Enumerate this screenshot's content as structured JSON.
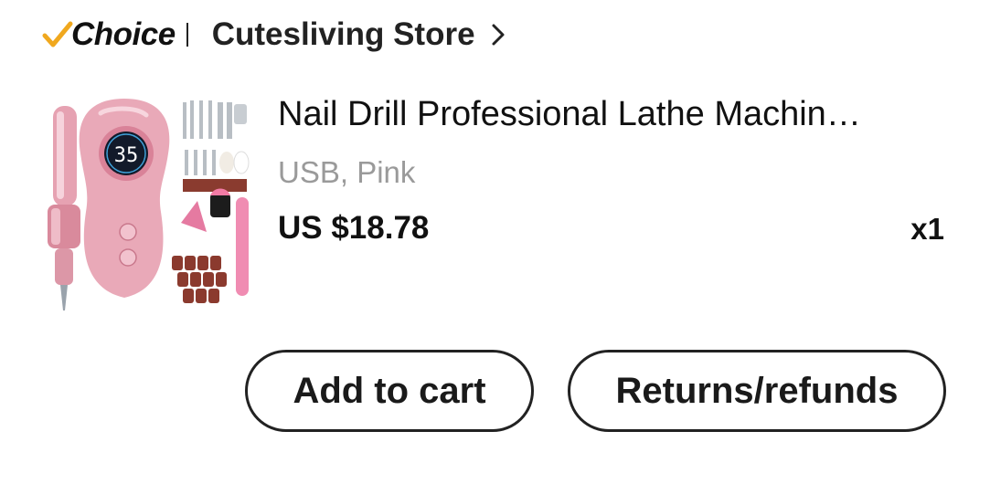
{
  "store": {
    "badge_text": "Choice",
    "badge_icon": "check-icon",
    "name": "Cutesliving Store",
    "chevron_icon": "chevron-right-icon"
  },
  "product": {
    "title": "Nail Drill Professional Lathe Machin…",
    "variant": "USB, Pink",
    "price": "US $18.78",
    "quantity": "x1",
    "lcd_reading": "35",
    "image_colors": {
      "body": "#e9a9b8",
      "accent": "#d98298",
      "lcd": "#121a2a"
    }
  },
  "actions": {
    "add_to_cart": "Add to cart",
    "returns": "Returns/refunds"
  },
  "colors": {
    "choice_check": "#f0a81e",
    "text": "#111111",
    "muted": "#9a9a9a"
  }
}
